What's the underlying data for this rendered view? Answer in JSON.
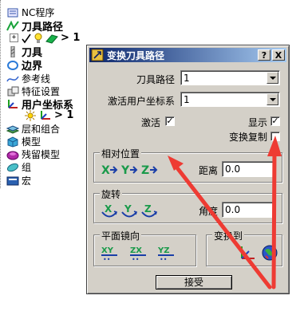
{
  "tree": {
    "nc_program": "NC程序",
    "toolpaths": "刀具路径",
    "toolpath_child_suffix": "> 1",
    "tools": "刀具",
    "boundaries": "边界",
    "patterns": "参考线",
    "features": "特征设置",
    "workplanes": "用户坐标系",
    "workplane_child_suffix": "> 1",
    "levels": "层和组合",
    "models": "模型",
    "stock_models": "残留模型",
    "groups": "组",
    "macros": "宏"
  },
  "dialog": {
    "title": "变换刀具路径",
    "help_btn": "?",
    "close_btn": "X",
    "toolpath_label": "刀具路径",
    "toolpath_value": "1",
    "workplane_label": "激活用户坐标系",
    "workplane_value": "1",
    "active_label": "激活",
    "active_checked": true,
    "show_label": "显示",
    "show_checked": true,
    "copy_label": "变换复制",
    "copy_checked": false,
    "relative_group": "相对位置",
    "distance_label": "距离",
    "distance_value": "0.0",
    "rotate_group": "旋转",
    "angle_label": "角度",
    "angle_value": "0.0",
    "mirror_group": "平面镜向",
    "transform_to_group": "变换到",
    "accept_btn": "接受",
    "check_mark": "✓"
  },
  "colors": {
    "title_start": "#0a246a",
    "title_end": "#a6caf0",
    "dialog_face": "#d4d0c8",
    "annotation_arrow": "#ee3b33",
    "axis_icon_green": "#1a9a4a",
    "axis_icon_blue": "#1a3ea8"
  }
}
